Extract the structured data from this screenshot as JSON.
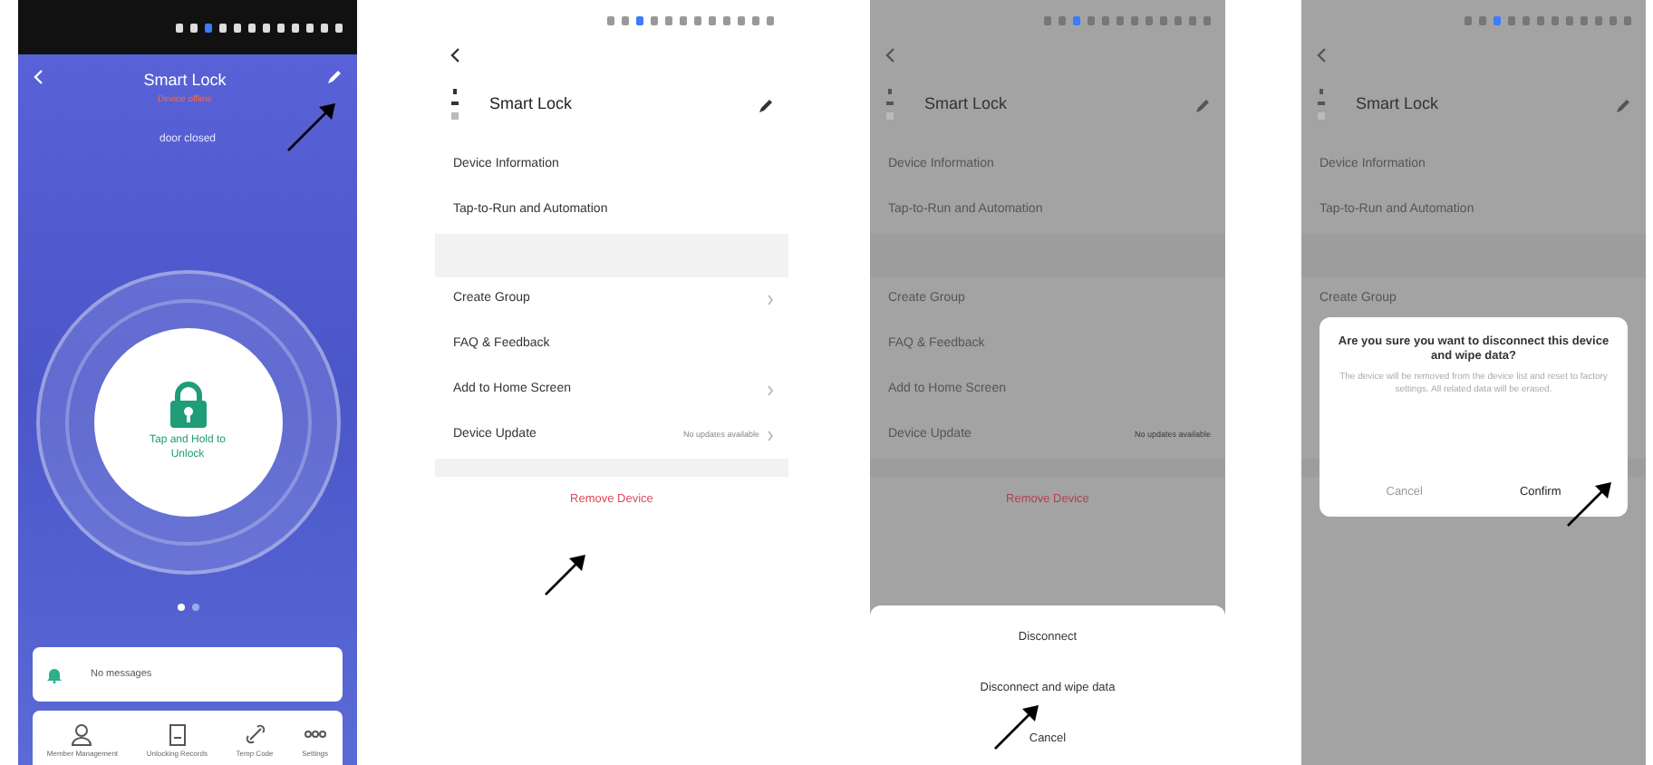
{
  "screens": [
    {
      "kind": "control",
      "title": "Smart Lock",
      "subtitle": "Device offline",
      "state_text": "door closed",
      "unlock_label": "Tap and Hold to Unlock",
      "pages": [
        {
          "selected": true
        },
        {
          "selected": false
        }
      ],
      "message": "No messages",
      "tabs": [
        {
          "label": "Member Management"
        },
        {
          "label": "Unlocking Records"
        },
        {
          "label": "Temp Code"
        },
        {
          "label": "Settings"
        }
      ]
    },
    {
      "kind": "settings",
      "dimmed": false,
      "device_name": "Smart Lock",
      "groups": [
        [
          {
            "label": "Device Information",
            "chevron": false
          },
          {
            "label": "Tap-to-Run and Automation",
            "chevron": false
          }
        ],
        [
          {
            "label": "Create Group",
            "chevron": true
          },
          {
            "label": "FAQ & Feedback",
            "chevron": false
          },
          {
            "label": "Add to Home Screen",
            "chevron": true
          },
          {
            "label": "Device Update",
            "value": "No updates available",
            "chevron": true
          }
        ]
      ],
      "remove_label": "Remove Device"
    },
    {
      "kind": "settings",
      "dimmed": true,
      "device_name": "Smart Lock",
      "groups": [
        [
          {
            "label": "Device Information",
            "chevron": false
          },
          {
            "label": "Tap-to-Run and Automation",
            "chevron": false
          }
        ],
        [
          {
            "label": "Create Group",
            "chevron": false
          },
          {
            "label": "FAQ & Feedback",
            "chevron": false
          },
          {
            "label": "Add to Home Screen",
            "chevron": false
          },
          {
            "label": "Device Update",
            "value": "No updates available",
            "chevron": false
          }
        ]
      ],
      "remove_label": "Remove Device",
      "sheet": {
        "options": [
          "Disconnect",
          "Disconnect and wipe data"
        ],
        "cancel": "Cancel"
      }
    },
    {
      "kind": "settings",
      "dimmed": true,
      "device_name": "Smart Lock",
      "groups": [
        [
          {
            "label": "Device Information",
            "chevron": false
          },
          {
            "label": "Tap-to-Run and Automation",
            "chevron": false
          }
        ],
        [
          {
            "label": "Create Group",
            "chevron": false
          }
        ]
      ],
      "dialog": {
        "title": "Are you sure you want to disconnect this device and wipe data?",
        "message": "The device will be removed from the device list and reset to factory settings. All related data will be erased.",
        "buttons": [
          "Cancel",
          "Confirm"
        ]
      }
    }
  ]
}
